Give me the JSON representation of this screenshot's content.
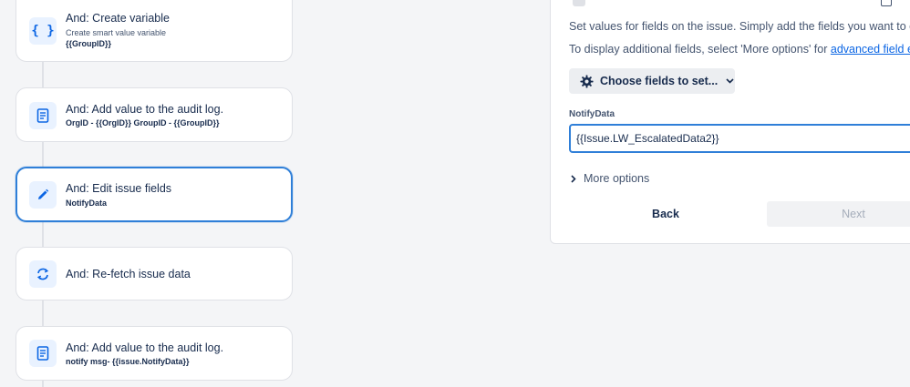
{
  "flow": {
    "items": [
      {
        "icon": "variable-icon",
        "title": "And: Create variable",
        "subtitle": "Create smart value variable",
        "detail": "{{GroupID}}"
      },
      {
        "icon": "audit-log-icon",
        "title": "And: Add value to the audit log.",
        "detail": "OrgID - {{OrgID}} GroupID - {{GroupID}}"
      },
      {
        "icon": "pencil-icon",
        "title": "And: Edit issue fields",
        "detail": "NotifyData"
      },
      {
        "icon": "refresh-icon",
        "title": "And: Re-fetch issue data"
      },
      {
        "icon": "audit-log-icon",
        "title": "And: Add value to the audit log.",
        "detail": "notify msg- {{issue.NotifyData}}"
      }
    ]
  },
  "panel": {
    "description_line1": "Set values for fields on the issue. Simply add the fields you want to edit.",
    "description_line2_prefix": "To display additional fields, select 'More options' for ",
    "description_link": "advanced field edit",
    "choose_fields_label": "Choose fields to set...",
    "field": {
      "label": "NotifyData",
      "value": "{{Issue.LW_EscalatedData2}}"
    },
    "more_options_label": "More options",
    "back_label": "Back",
    "next_label": "Next"
  },
  "colors": {
    "accent": "#2f7fd8",
    "link": "#0c66e4",
    "icon_bg": "#e9f2ff"
  }
}
